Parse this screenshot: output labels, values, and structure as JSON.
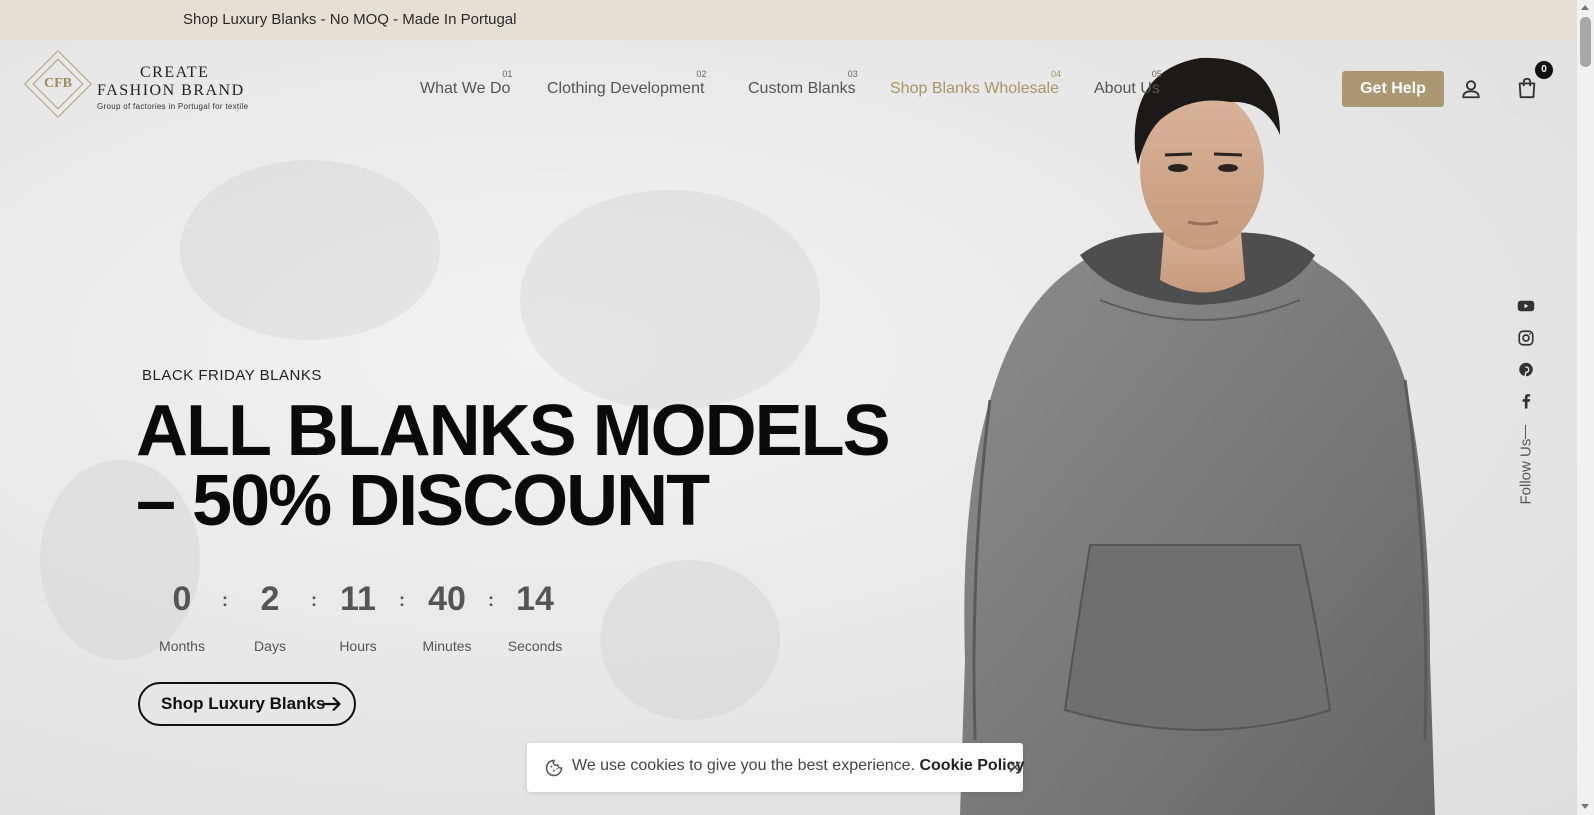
{
  "announcement": "Shop Luxury Blanks - No MOQ - Made In Portugal",
  "logo": {
    "line1": "CREATE",
    "line2": "FASHION BRAND",
    "tagline": "Group of factories in Portugal for textile",
    "monogram": "CFB"
  },
  "nav": [
    {
      "num": "01",
      "label": "What We Do"
    },
    {
      "num": "02",
      "label": "Clothing Development"
    },
    {
      "num": "03",
      "label": "Custom Blanks"
    },
    {
      "num": "04",
      "label": "Shop Blanks Wholesale",
      "active": true
    },
    {
      "num": "05",
      "label": "About Us"
    }
  ],
  "header": {
    "help_label": "Get Help",
    "cart_count": "0"
  },
  "hero": {
    "kicker": "BLACK FRIDAY BLANKS",
    "headline_line1": "ALL BLANKS MODELS",
    "headline_line2": "– 50% DISCOUNT",
    "cta_label": "Shop Luxury Blanks"
  },
  "countdown": [
    {
      "value": "0",
      "label": "Months"
    },
    {
      "value": "2",
      "label": "Days"
    },
    {
      "value": "11",
      "label": "Hours"
    },
    {
      "value": "40",
      "label": "Minutes"
    },
    {
      "value": "14",
      "label": "Seconds"
    }
  ],
  "countdown_separator": ":",
  "social": {
    "follow_label": "Follow Us",
    "icons": [
      "youtube-icon",
      "instagram-icon",
      "pinterest-icon",
      "facebook-icon"
    ]
  },
  "cookie": {
    "text": "We use cookies to give you the best experience.",
    "link": "Cookie Policy"
  },
  "colors": {
    "accent": "#a99872",
    "announcement_bg": "#e6e0d4",
    "headline": "#0a0a0a"
  }
}
